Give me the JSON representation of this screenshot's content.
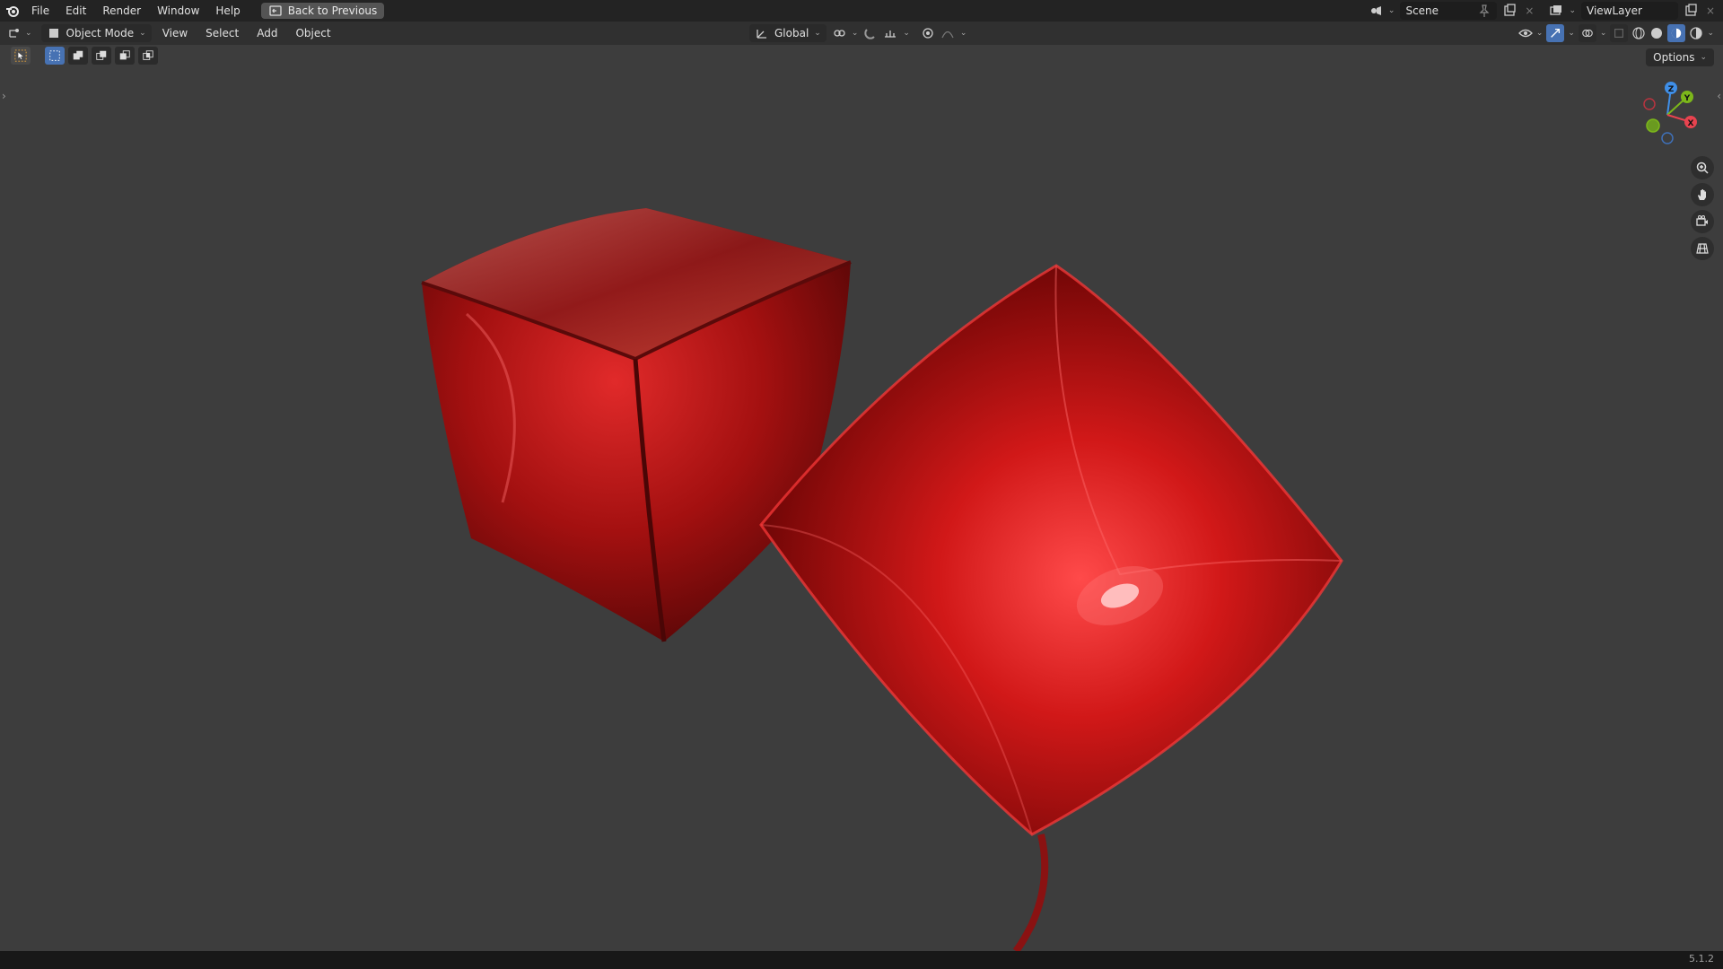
{
  "menu": [
    "File",
    "Edit",
    "Render",
    "Window",
    "Help"
  ],
  "back_button": "Back to Previous",
  "scene": {
    "label": "Scene"
  },
  "view_layer": {
    "label": "ViewLayer"
  },
  "header": {
    "mode": "Object Mode",
    "menus": [
      "View",
      "Select",
      "Add",
      "Object"
    ],
    "transform_orientation": "Global"
  },
  "options_label": "Options",
  "gizmo": {
    "z": "Z",
    "y": "Y",
    "x": "X"
  },
  "version": "5.1.2",
  "colors": {
    "balloon_red": "#d11818",
    "x_axis": "#e8434f",
    "y_axis": "#7cb71a",
    "z_axis": "#3f8fe8",
    "accent": "#4772b3"
  }
}
